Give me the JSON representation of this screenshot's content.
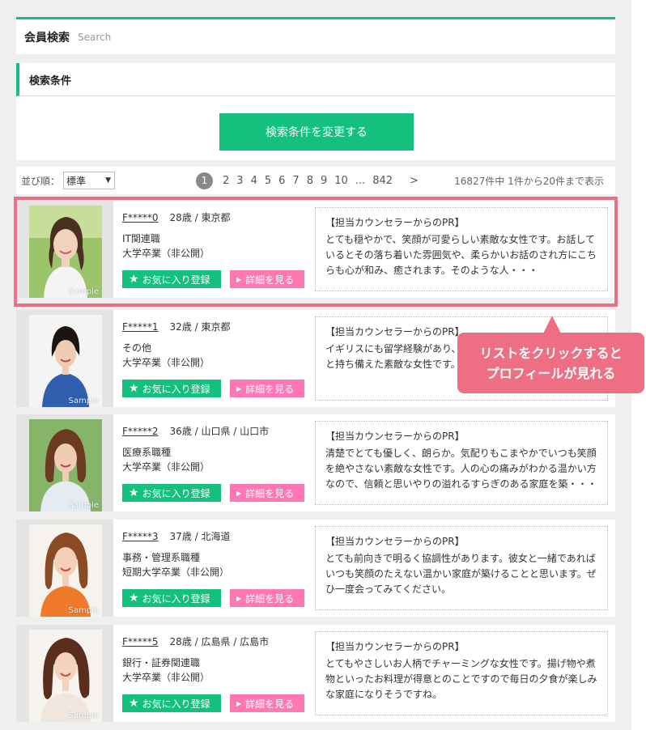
{
  "header": {
    "title": "会員検索",
    "subtitle": "Search"
  },
  "conditions": {
    "heading": "検索条件",
    "change_button": "検索条件を変更する"
  },
  "sort": {
    "label": "並び順：",
    "selected": "標準"
  },
  "pager": {
    "current": "1",
    "pages": [
      "2",
      "3",
      "4",
      "5",
      "6",
      "7",
      "8",
      "9",
      "10",
      "...",
      "842"
    ],
    "next": ">",
    "summary": "16827件中 1件から20件まで表示"
  },
  "members": [
    {
      "id": "F*****0",
      "age": "28歳 / 東京都",
      "job": "IT関連職",
      "education": "大学卒業（非公開）",
      "pr_title": "【担当カウンセラーからのPR】",
      "pr_text": "とても穏やかで、笑顔が可愛らしい素敵な女性です。お話しているとその落ち着いた雰囲気や、柔らかいお話のされ方にこちらも心が和み、癒されます。そのような人・・・",
      "sample": "Sample"
    },
    {
      "id": "F*****1",
      "age": "32歳 / 東京都",
      "job": "その他",
      "education": "大学卒業（非公開）",
      "pr_title": "【担当カウンセラーからのPR】",
      "pr_text": "イギリスにも留学経験があり、かな方です。奥ゆかしさや人へと持ち備えた素敵な女性です。",
      "sample": "Sample"
    },
    {
      "id": "F*****2",
      "age": "36歳 / 山口県 / 山口市",
      "job": "医療系職種",
      "education": "大学卒業（非公開）",
      "pr_title": "【担当カウンセラーからのPR】",
      "pr_text": "清楚でとても優しく、朗らか。気配りもこまやかでいつも笑顔を絶やさない素敵な女性です。人の心の痛みがわかる温かい方なので、信頼と思いやりの溢れるすらぎのある家庭を築・・・",
      "sample": "Sample"
    },
    {
      "id": "F*****3",
      "age": "37歳 / 北海道",
      "job": "事務・管理系職種",
      "education": "短期大学卒業（非公開）",
      "pr_title": "【担当カウンセラーからのPR】",
      "pr_text": "とても前向きで明るく協調性があります。彼女と一緒であればいつも笑顔のたえない温かい家庭が築けることと思います。ぜひ一度会ってみてください。",
      "sample": "Sample"
    },
    {
      "id": "F*****5",
      "age": "28歳 / 広島県 / 広島市",
      "job": "銀行・証券関連職",
      "education": "大学卒業（非公開）",
      "pr_title": "【担当カウンセラーからのPR】",
      "pr_text": "とてもやさしいお人柄でチャーミングな女性です。揚げ物や煮物といったお料理が得意とのことですので毎日の夕食が楽しみな家庭になりそうですね。",
      "sample": "Sample"
    }
  ],
  "buttons": {
    "favorite": "お気に入り登録",
    "detail": "詳細を見る"
  },
  "callout": {
    "line1": "リストをクリックすると",
    "line2": "プロフィールが見れる"
  },
  "colors": {
    "accent": "#13c07e",
    "pink": "#ff78b3",
    "highlight": "#ee6f84"
  }
}
